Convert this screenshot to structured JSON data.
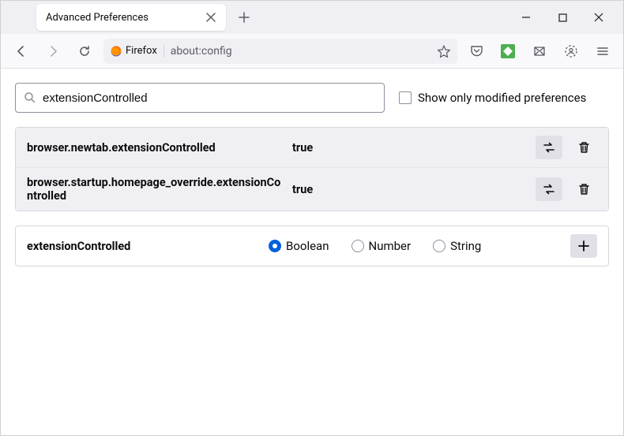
{
  "tab": {
    "title": "Advanced Preferences"
  },
  "urlbar": {
    "identity_label": "Firefox",
    "url": "about:config"
  },
  "search": {
    "value": "extensionControlled",
    "show_modified_label": "Show only modified preferences"
  },
  "prefs": [
    {
      "name": "browser.newtab.extensionControlled",
      "value": "true"
    },
    {
      "name": "browser.startup.homepage_override.extensionControlled",
      "value": "true"
    }
  ],
  "create": {
    "name": "extensionControlled",
    "types": {
      "boolean": "Boolean",
      "number": "Number",
      "string": "String"
    },
    "selected": "boolean"
  }
}
